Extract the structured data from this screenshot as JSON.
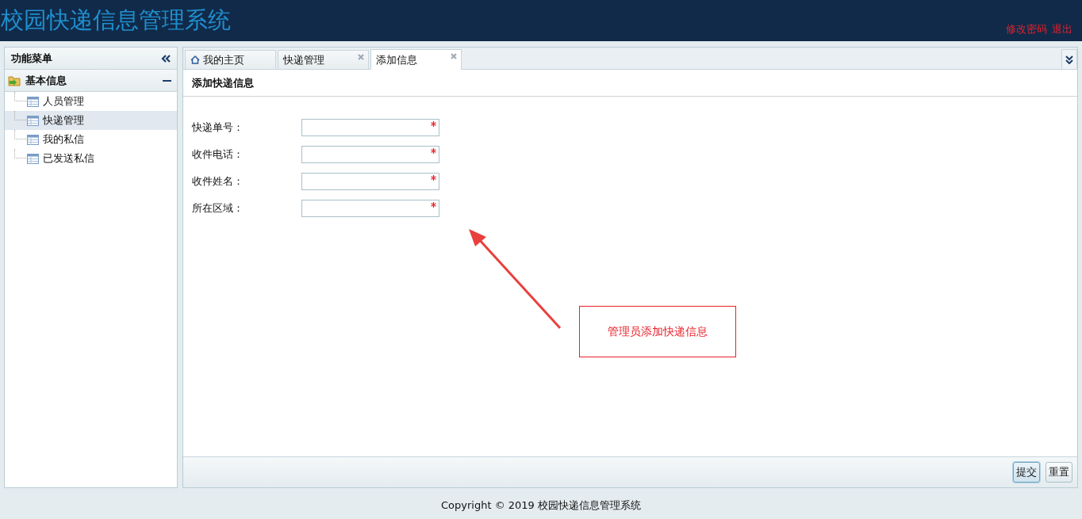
{
  "header": {
    "title": "校园快递信息管理系统",
    "links": [
      "修改密码",
      "退出"
    ]
  },
  "sidebar": {
    "title": "功能菜单",
    "group": {
      "label": "基本信息",
      "expanded": true,
      "items": [
        {
          "label": "人员管理",
          "selected": false
        },
        {
          "label": "快递管理",
          "selected": true
        },
        {
          "label": "我的私信",
          "selected": false
        },
        {
          "label": "已发送私信",
          "selected": false
        }
      ]
    }
  },
  "tabs": [
    {
      "label": "我的主页",
      "kind": "home",
      "selected": false
    },
    {
      "label": "快递管理",
      "kind": "closable",
      "selected": false
    },
    {
      "label": "添加信息",
      "kind": "closable",
      "selected": true
    }
  ],
  "form": {
    "title": "添加快递信息",
    "fields": [
      {
        "label": "快递单号：",
        "required": true
      },
      {
        "label": "收件电话：",
        "required": true
      },
      {
        "label": "收件姓名：",
        "required": true
      },
      {
        "label": "所在区域：",
        "required": true
      }
    ],
    "buttons": [
      {
        "label": "提交",
        "focused": true
      },
      {
        "label": "重置",
        "focused": false
      }
    ]
  },
  "annotation": {
    "text": "管理员添加快递信息"
  },
  "footer": "Copyright © 2019 校园快递信息管理系统"
}
